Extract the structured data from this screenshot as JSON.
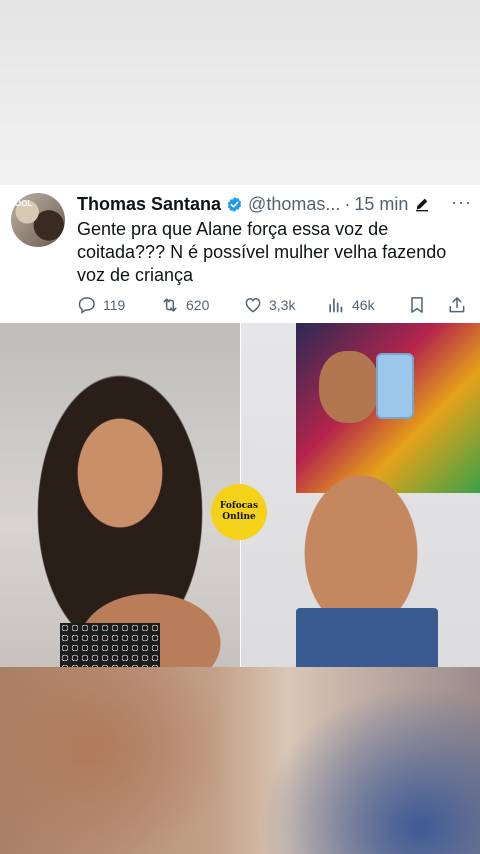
{
  "tweet": {
    "avatar_caption": "OOL",
    "name": "Thomas Santana",
    "handle": "@thomas...",
    "separator": "·",
    "time": "15 min",
    "more": "···",
    "text": "Gente pra que Alane força essa voz de coitada??? N é possível mulher velha fazendo voz de criança",
    "actions": {
      "replies": "119",
      "retweets": "620",
      "likes": "3,3k",
      "views": "46k"
    },
    "colors": {
      "verified": "#1d9bf0",
      "muted": "#536471",
      "text": "#0f1419"
    }
  },
  "media": {
    "badge_line1": "Fofocas",
    "badge_line2": "Online",
    "badge_color": "#f4d21a"
  },
  "icons": [
    "verified-icon",
    "edit-icon",
    "more-icon",
    "reply-icon",
    "retweet-icon",
    "like-icon",
    "views-icon",
    "bookmark-icon",
    "share-icon"
  ]
}
